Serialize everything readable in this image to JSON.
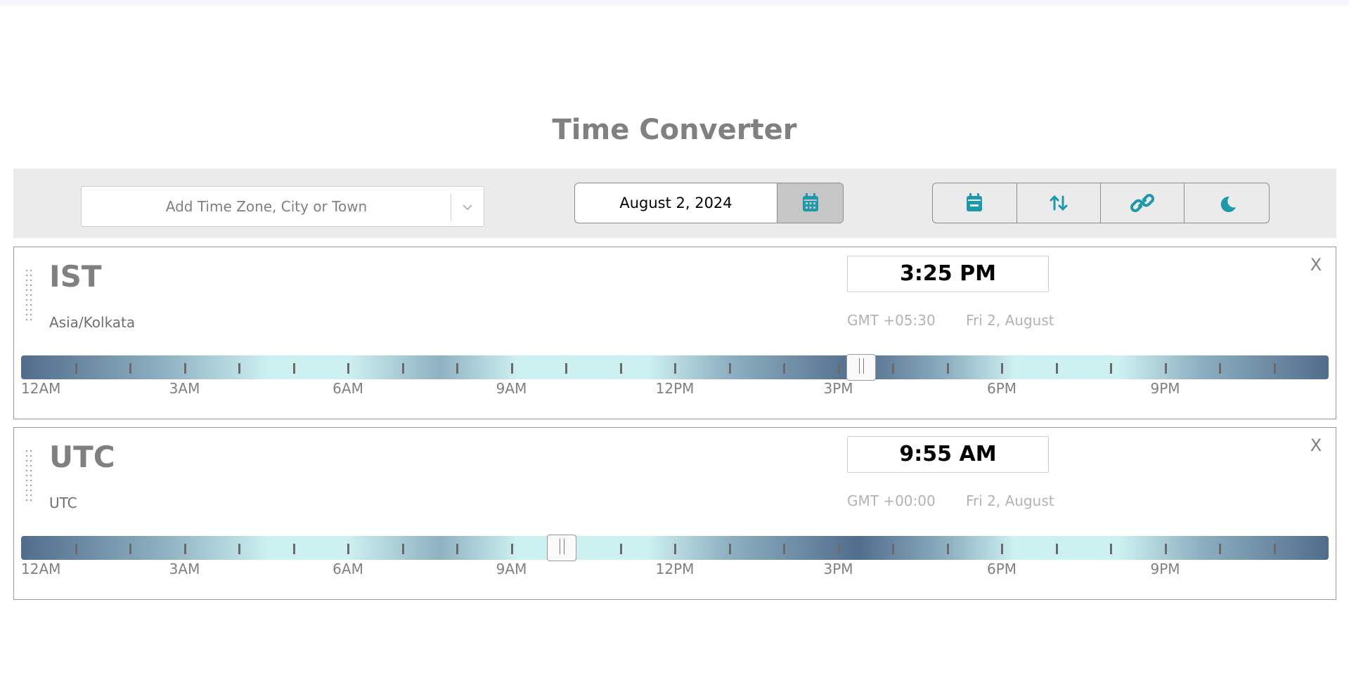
{
  "page": {
    "title": "Time Converter"
  },
  "toolbar": {
    "timezone_search": {
      "placeholder": "Add Time Zone, City or Town",
      "dropdown_icon": "chevron-down-icon"
    },
    "date": {
      "value": "August 2, 2024",
      "picker_icon": "calendar-icon"
    },
    "actions": [
      {
        "icon": "calendar-event-icon"
      },
      {
        "icon": "sort-arrows-icon"
      },
      {
        "icon": "link-icon"
      },
      {
        "icon": "moon-icon"
      }
    ]
  },
  "scale": {
    "hour_labels": [
      "12AM",
      "3AM",
      "6AM",
      "9AM",
      "12PM",
      "3PM",
      "6PM",
      "9PM"
    ],
    "tick_count": 24,
    "colors": {
      "night": "#516d8c",
      "dusk": "#8fb1c2",
      "day": "#cdf0f0"
    }
  },
  "zones": [
    {
      "abbr": "IST",
      "name": "Asia/Kolkata",
      "time": "3:25 PM",
      "offset": "GMT +05:30",
      "date": "Fri 2, August",
      "close": "X",
      "slider_hour": 15.42
    },
    {
      "abbr": "UTC",
      "name": "UTC",
      "time": "9:55 AM",
      "offset": "GMT +00:00",
      "date": "Fri 2, August",
      "close": "X",
      "slider_hour": 9.92
    }
  ],
  "colors": {
    "accent": "#1c9aac",
    "title": "#808080",
    "toolbar_bg": "#ebebeb"
  }
}
